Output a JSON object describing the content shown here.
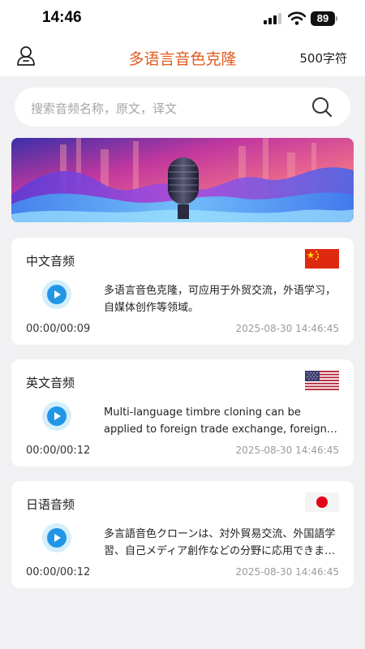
{
  "status_bar": {
    "time": "14:46",
    "battery": "89"
  },
  "header": {
    "title": "多语言音色克隆",
    "char_count": "500字符"
  },
  "search": {
    "placeholder": "搜索音频名称，原文，译文"
  },
  "colors": {
    "accent": "#e05a1e",
    "play": "#2196e6",
    "background": "#f1f1f3"
  },
  "cards": [
    {
      "title": "中文音频",
      "flag": "china-flag",
      "text": "多语言音色克隆，可应用于外贸交流，外语学习，自媒体创作等领域。",
      "duration": "00:00/00:09",
      "timestamp": "2025-08-30 14:46:45"
    },
    {
      "title": "英文音频",
      "flag": "usa-flag",
      "text": "Multi-language timbre cloning can be applied to foreign trade exchange, foreign language learning, self-media creation and other fields.",
      "duration": "00:00/00:12",
      "timestamp": "2025-08-30 14:46:45"
    },
    {
      "title": "日语音频",
      "flag": "japan-flag",
      "text": "多言語音色クローンは、対外貿易交流、外国語学習、自己メディア創作などの分野に応用できます。",
      "duration": "00:00/00:12",
      "timestamp": "2025-08-30 14:46:45"
    }
  ]
}
